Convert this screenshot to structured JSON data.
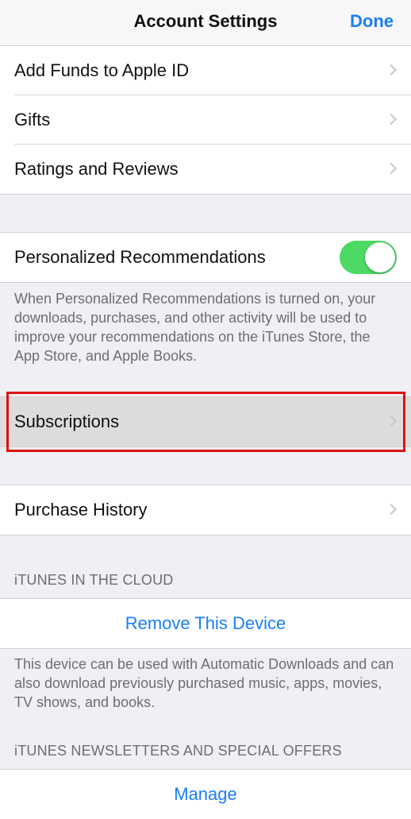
{
  "nav": {
    "title": "Account Settings",
    "done_label": "Done"
  },
  "account_group": {
    "items": [
      {
        "label": "Add Funds to Apple ID"
      },
      {
        "label": "Gifts"
      },
      {
        "label": "Ratings and Reviews"
      }
    ]
  },
  "personalized": {
    "label": "Personalized Recommendations",
    "toggle_on": true,
    "toggle_color": "#4cd964",
    "footnote": "When Personalized Recommendations is turned on, your downloads, purchases, and other activity will be used to improve your recommendations on the iTunes Store, the App Store, and Apple Books."
  },
  "subscriptions": {
    "label": "Subscriptions",
    "highlight_color": "#e01010"
  },
  "purchase_history": {
    "label": "Purchase History"
  },
  "itunes_cloud": {
    "header": "iTUNES IN THE CLOUD",
    "action_label": "Remove This Device",
    "footnote": "This device can be used with Automatic Downloads and can also download previously purchased music, apps, movies, TV shows, and books."
  },
  "newsletters": {
    "header": "iTUNES NEWSLETTERS AND SPECIAL OFFERS",
    "action_label": "Manage"
  },
  "colors": {
    "accent": "#1a7ff6",
    "background": "#efeff4"
  }
}
